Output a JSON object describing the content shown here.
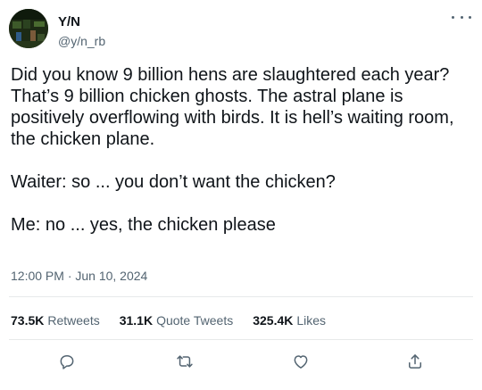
{
  "author": {
    "display_name": "Y/N",
    "handle": "@y/n_rb"
  },
  "tweet": {
    "text": "Did you know 9 billion hens are slaughtered each year? That’s 9 billion chicken ghosts. The astral plane is positively overflowing with birds. It is hell’s waiting room, the chicken plane.\n\nWaiter: so ... you don’t want the chicken?\n\nMe: no ... yes, the chicken please",
    "timestamp": "12:00 PM · Jun 10, 2024"
  },
  "stats": {
    "retweets": {
      "count": "73.5K",
      "label": "Retweets"
    },
    "quote_tweets": {
      "count": "31.1K",
      "label": "Quote Tweets"
    },
    "likes": {
      "count": "325.4K",
      "label": "Likes"
    }
  },
  "actions": {
    "icons": [
      "reply-icon",
      "retweet-icon",
      "like-icon",
      "share-icon"
    ]
  },
  "colors": {
    "text": "#0f1419",
    "secondary": "#536471",
    "divider": "#e7e9ea"
  }
}
